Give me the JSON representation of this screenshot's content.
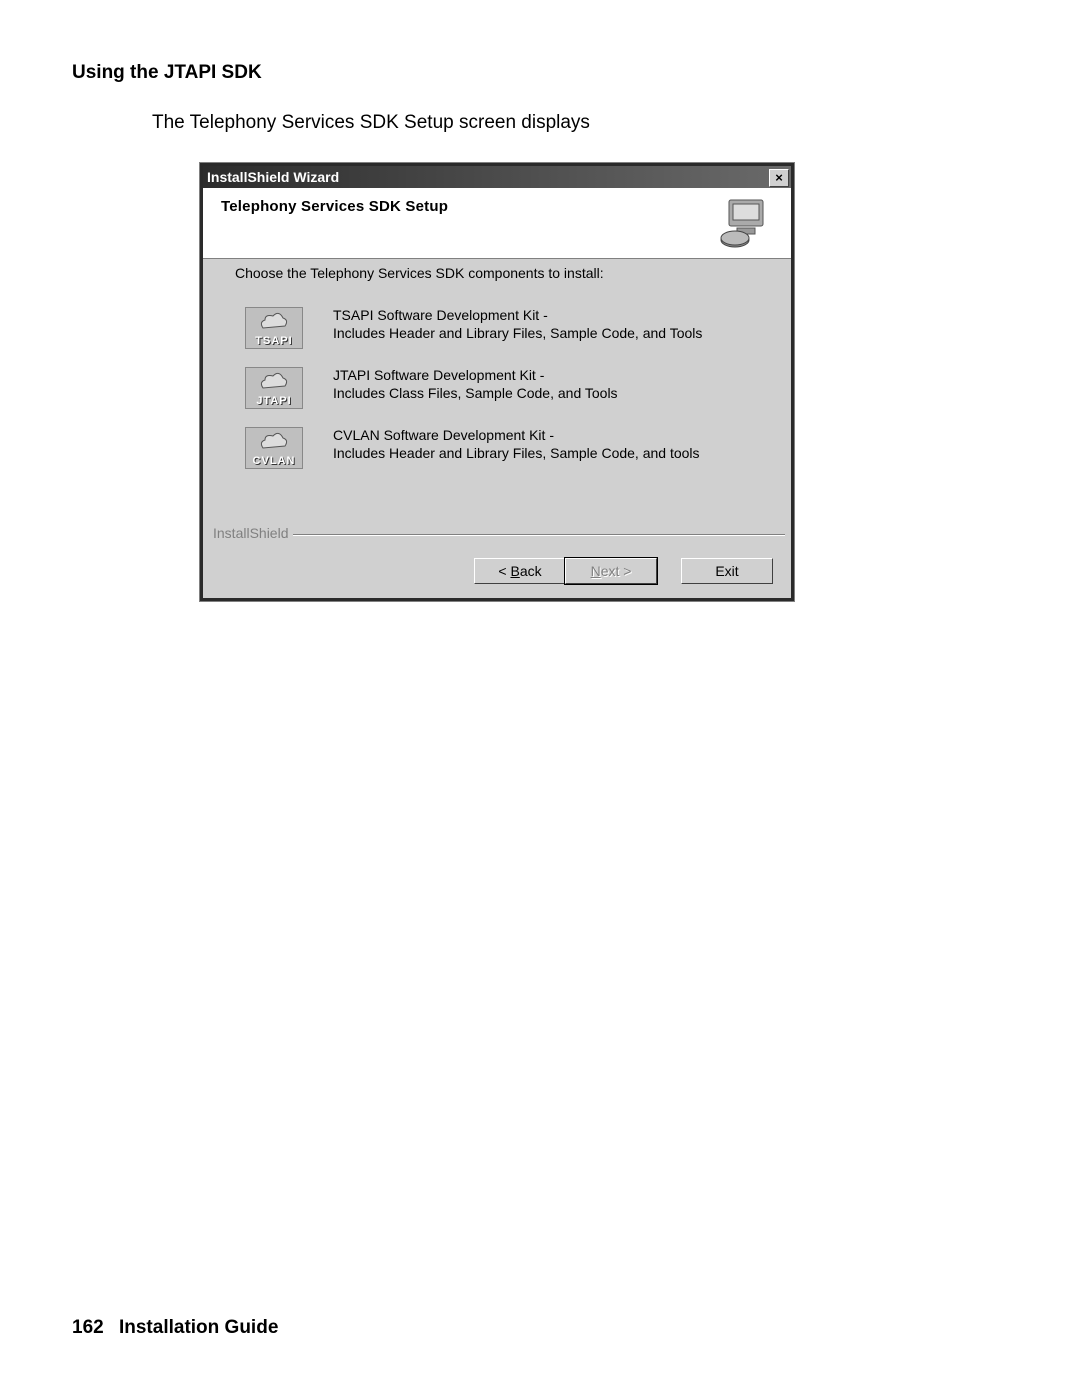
{
  "doc": {
    "section_heading": "Using the JTAPI SDK",
    "intro_text": "The Telephony Services SDK Setup screen displays",
    "page_number": "162",
    "footer_title": "Installation Guide"
  },
  "dialog": {
    "window_title": "InstallShield Wizard",
    "close_symbol": "×",
    "banner_title": "Telephony Services SDK Setup",
    "choose_text": "Choose the Telephony Services SDK components to install:",
    "options": [
      {
        "icon_label": "TSAPI",
        "line1": "TSAPI Software Development Kit -",
        "line2": "Includes Header and Library Files, Sample Code, and Tools"
      },
      {
        "icon_label": "JTAPI",
        "line1": "JTAPI Software Development Kit -",
        "line2": "Includes Class Files, Sample Code, and Tools"
      },
      {
        "icon_label": "CVLAN",
        "line1": "CVLAN Software Development Kit -",
        "line2": "Includes Header and Library Files, Sample Code, and tools"
      }
    ],
    "group_label": "InstallShield",
    "buttons": {
      "back_prefix": "< ",
      "back_u": "B",
      "back_suffix": "ack",
      "next_u": "N",
      "next_suffix": "ext >",
      "exit": "Exit"
    }
  }
}
